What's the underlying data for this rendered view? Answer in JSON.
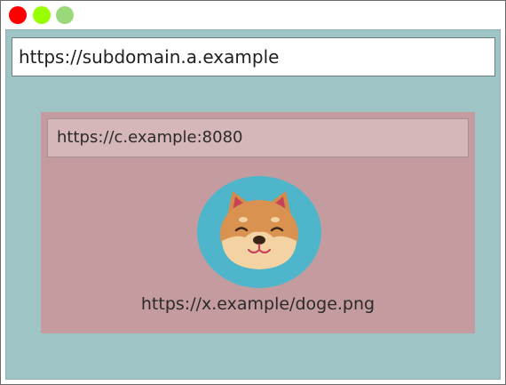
{
  "window": {
    "controls": {
      "close_color": "#ff0000",
      "minimize_color": "#99ff00",
      "maximize_color": "#99d97a"
    }
  },
  "browser": {
    "url": "https://subdomain.a.example",
    "viewport_color": "#9fc4c6"
  },
  "iframe": {
    "url": "https://c.example:8080",
    "background_color": "#c49c9f",
    "image": {
      "icon": "shiba-dog-icon",
      "caption": "https://x.example/doge.png"
    }
  }
}
